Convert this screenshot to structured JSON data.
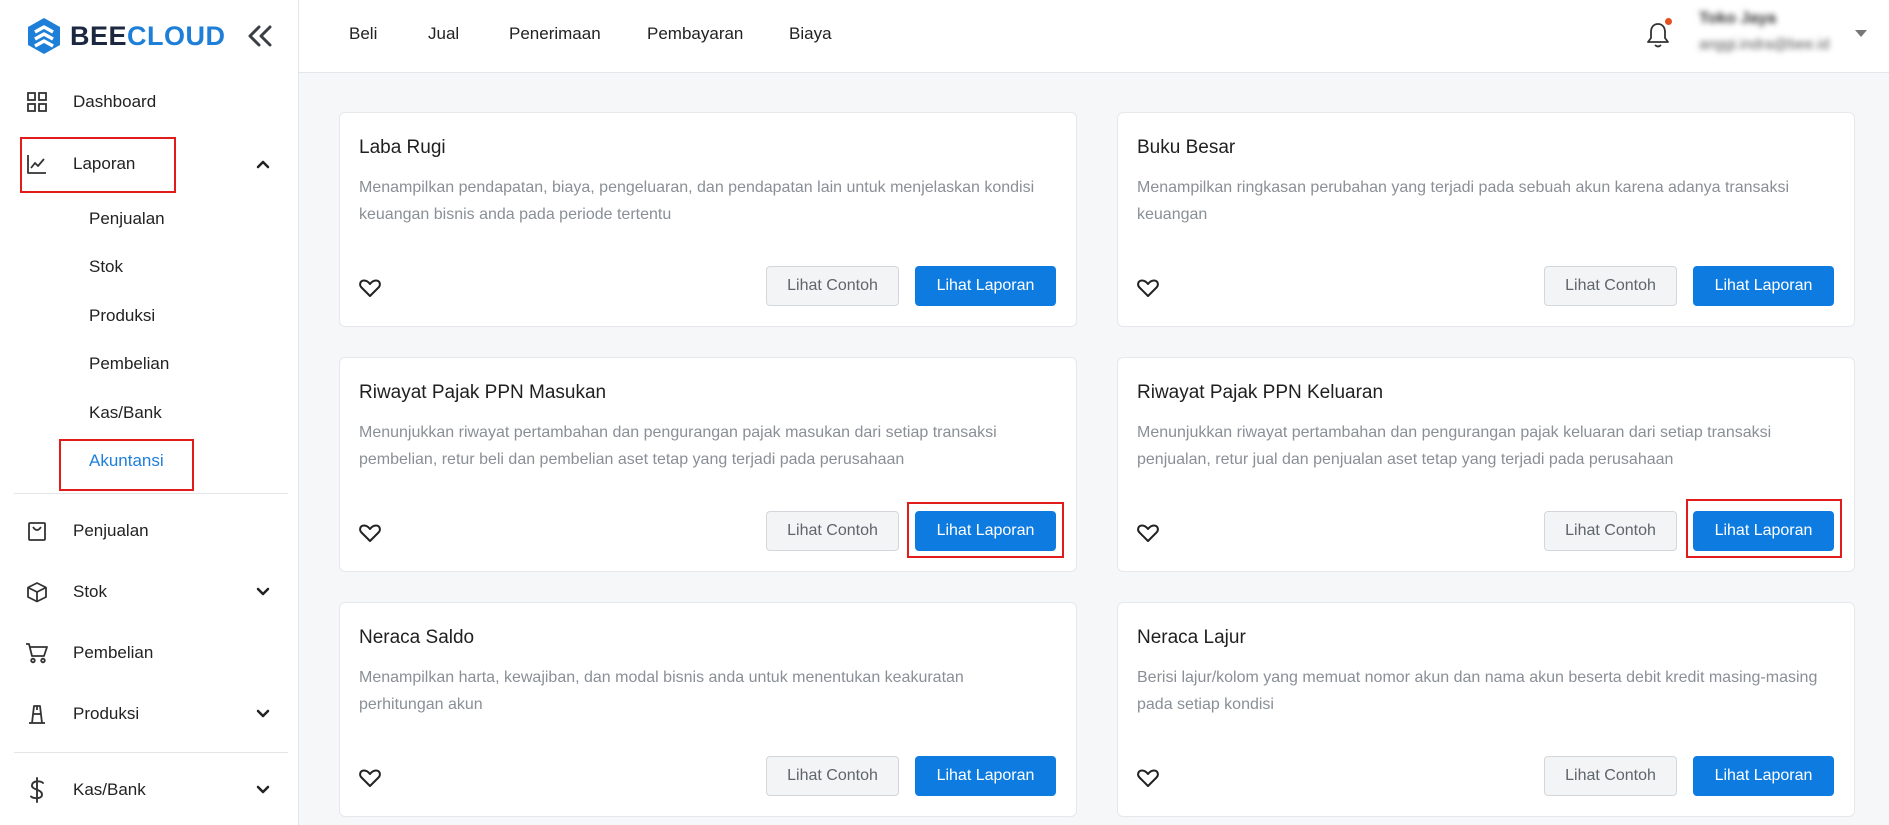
{
  "brand": {
    "part1": "BEE",
    "part2": "CLOUD",
    "primary_color": "#1e7fd9",
    "dark_color": "#1c2840"
  },
  "sidebar": {
    "items": [
      {
        "label": "Dashboard",
        "icon": "dashboard-grid-icon"
      },
      {
        "label": "Laporan",
        "icon": "line-chart-icon",
        "expanded": true
      },
      {
        "label": "Penjualan",
        "icon": "shopping-bag-icon"
      },
      {
        "label": "Stok",
        "icon": "box-icon"
      },
      {
        "label": "Pembelian",
        "icon": "cart-icon"
      },
      {
        "label": "Produksi",
        "icon": "factory-icon"
      },
      {
        "label": "Kas/Bank",
        "icon": "dollar-icon"
      }
    ],
    "laporan_sub": [
      "Penjualan",
      "Stok",
      "Produksi",
      "Pembelian",
      "Kas/Bank",
      "Akuntansi"
    ],
    "active_sub": "Akuntansi"
  },
  "topnav": [
    "Beli",
    "Jual",
    "Penerimaan",
    "Pembayaran",
    "Biaya"
  ],
  "user": {
    "name": "Toko Jaya",
    "email": "anggi.indra@bee.id"
  },
  "cards": [
    {
      "title": "Laba Rugi",
      "desc": "Menampilkan pendapatan, biaya, pengeluaran, dan pendapatan lain untuk menjelaskan kondisi keuangan bisnis anda pada periode tertentu",
      "btn_example": "Lihat Contoh",
      "btn_report": "Lihat Laporan"
    },
    {
      "title": "Buku Besar",
      "desc": "Menampilkan ringkasan perubahan yang terjadi pada sebuah akun karena adanya transaksi keuangan",
      "btn_example": "Lihat Contoh",
      "btn_report": "Lihat Laporan"
    },
    {
      "title": "Riwayat Pajak PPN Masukan",
      "desc": "Menunjukkan riwayat pertambahan dan pengurangan pajak masukan dari setiap transaksi pembelian, retur beli dan pembelian aset tetap yang terjadi pada perusahaan",
      "btn_example": "Lihat Contoh",
      "btn_report": "Lihat Laporan"
    },
    {
      "title": "Riwayat Pajak PPN Keluaran",
      "desc": "Menunjukkan riwayat pertambahan dan pengurangan pajak keluaran dari setiap transaksi penjualan, retur jual dan penjualan aset tetap yang terjadi pada perusahaan",
      "btn_example": "Lihat Contoh",
      "btn_report": "Lihat Laporan"
    },
    {
      "title": "Neraca Saldo",
      "desc": "Menampilkan harta, kewajiban, dan modal bisnis anda untuk menentukan keakuratan perhitungan akun",
      "btn_example": "Lihat Contoh",
      "btn_report": "Lihat Laporan"
    },
    {
      "title": "Neraca Lajur",
      "desc": "Berisi lajur/kolom yang memuat nomor akun dan nama akun beserta debit kredit masing-masing pada setiap kondisi",
      "btn_example": "Lihat Contoh",
      "btn_report": "Lihat Laporan"
    }
  ],
  "highlight_color": "#e21b1b"
}
